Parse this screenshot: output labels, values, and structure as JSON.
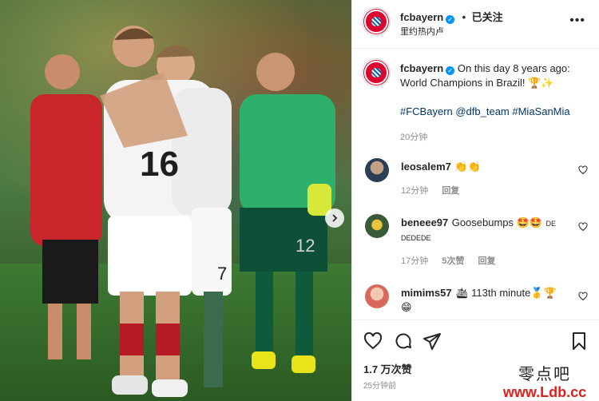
{
  "post": {
    "username": "fcbayern",
    "follow_status": "已关注",
    "location": "里约热内卢",
    "caption": "On this day 8 years ago: World Champions in Brazil! 🏆✨",
    "hashtags": "#FCBayern @dfb_team #MiaSanMia",
    "caption_time": "20分钟",
    "likes": "1.7 万次赞",
    "posted_ago": "25分钟前",
    "jersey_numbers": [
      "16",
      "7",
      "12"
    ]
  },
  "comments": [
    {
      "user": "leosalem7",
      "text": "👏👏",
      "time": "12分钟",
      "reply": "回复",
      "likes": ""
    },
    {
      "user": "beneee97",
      "text": "Goosebumps 🤩🤩",
      "extra": "DE DEDEDE",
      "time": "17分钟",
      "likes": "5次赞",
      "reply": "回复"
    },
    {
      "user": "mimims57",
      "text": "🛳 113th minute🥇🏆",
      "extra": "😁",
      "time": "",
      "reply": "",
      "likes": ""
    }
  ],
  "watermark": {
    "cn": "零点吧",
    "url": "www.Ldb.cc"
  },
  "colors": {
    "brand_red": "#dc052d",
    "link_blue": "#00376b",
    "verified": "#0095f6"
  },
  "icons": [
    "verified-badge-icon",
    "more-options-icon",
    "heart-icon",
    "comment-icon",
    "share-icon",
    "bookmark-icon",
    "chevron-right-icon"
  ]
}
